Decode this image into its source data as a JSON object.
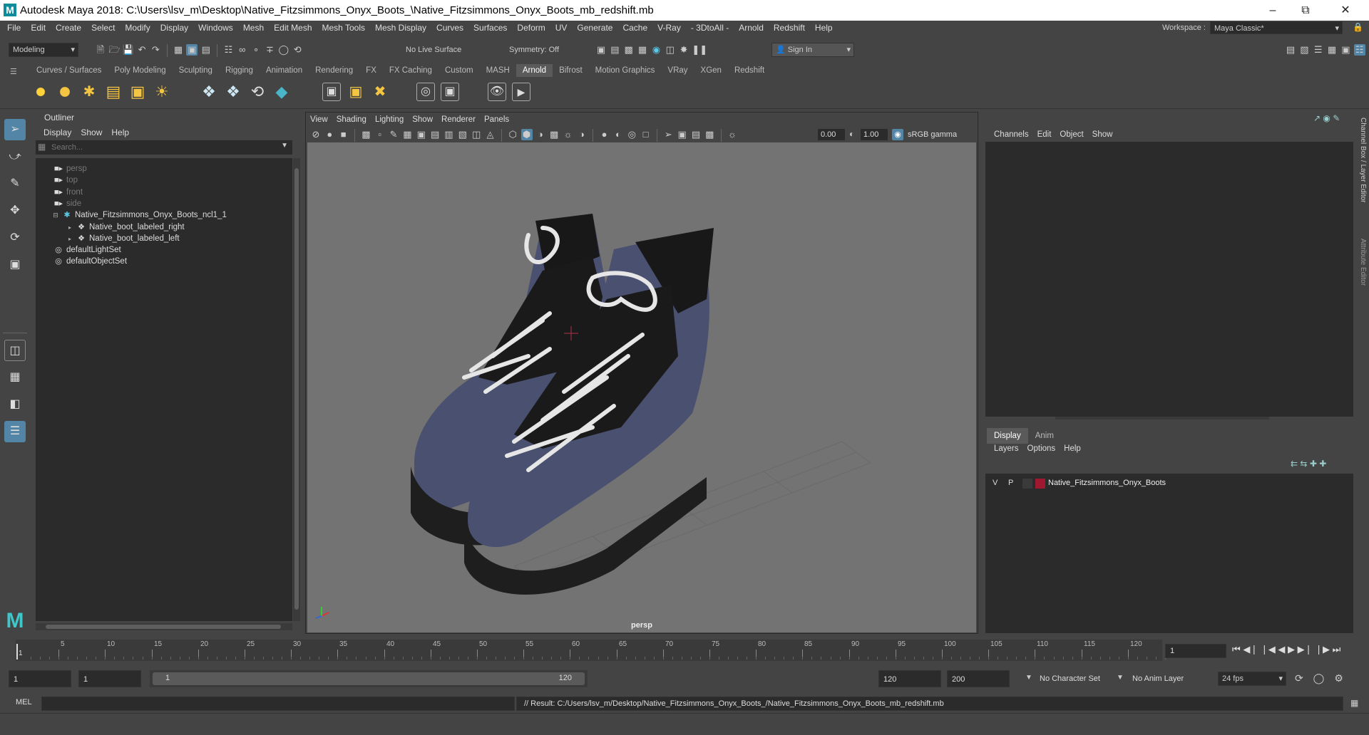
{
  "app": {
    "title": "Autodesk Maya 2018: C:\\Users\\lsv_m\\Desktop\\Native_Fitzsimmons_Onyx_Boots_\\Native_Fitzsimmons_Onyx_Boots_mb_redshift.mb",
    "logo_letter": "M",
    "accent_color": "#5285a6"
  },
  "menubar": [
    "File",
    "Edit",
    "Create",
    "Select",
    "Modify",
    "Display",
    "Windows",
    "Mesh",
    "Edit Mesh",
    "Mesh Tools",
    "Mesh Display",
    "Curves",
    "Surfaces",
    "Deform",
    "UV",
    "Generate",
    "Cache",
    "V-Ray",
    "- 3DtoAll -",
    "Arnold",
    "Redshift",
    "Help"
  ],
  "workspace": {
    "label": "Workspace :",
    "value": "Maya Classic*"
  },
  "statusline": {
    "mode": "Modeling",
    "live_surface": "No Live Surface",
    "symmetry": "Symmetry: Off",
    "sign_in": "Sign In"
  },
  "shelf_tabs": [
    "Curves / Surfaces",
    "Poly Modeling",
    "Sculpting",
    "Rigging",
    "Animation",
    "Rendering",
    "FX",
    "FX Caching",
    "Custom",
    "MASH",
    "Arnold",
    "Bifrost",
    "Motion Graphics",
    "VRay",
    "XGen",
    "Redshift"
  ],
  "active_shelf": "Arnold",
  "outliner": {
    "title": "Outliner",
    "menu": [
      "Display",
      "Show",
      "Help"
    ],
    "search_placeholder": "Search...",
    "items": [
      {
        "label": "persp",
        "icon": "camera-icon",
        "dim": true
      },
      {
        "label": "top",
        "icon": "camera-icon",
        "dim": true
      },
      {
        "label": "front",
        "icon": "camera-icon",
        "dim": true
      },
      {
        "label": "side",
        "icon": "camera-icon",
        "dim": true
      },
      {
        "label": "Native_Fitzsimmons_Onyx_Boots_ncl1_1",
        "icon": "group-icon",
        "dim": false
      },
      {
        "label": "Native_boot_labeled_right",
        "icon": "mesh-icon",
        "dim": false
      },
      {
        "label": "Native_boot_labeled_left",
        "icon": "mesh-icon",
        "dim": false
      },
      {
        "label": "defaultLightSet",
        "icon": "set-icon",
        "dim": false
      },
      {
        "label": "defaultObjectSet",
        "icon": "set-icon",
        "dim": false
      }
    ]
  },
  "viewport": {
    "menu": [
      "View",
      "Shading",
      "Lighting",
      "Show",
      "Renderer",
      "Panels"
    ],
    "exposure": "0.00",
    "gamma": "1.00",
    "color_space": "sRGB gamma",
    "camera_label": "persp"
  },
  "channelbox": {
    "menu": [
      "Channels",
      "Edit",
      "Object",
      "Show"
    ],
    "side_tabs": [
      "Channel Box / Layer Editor",
      "Attribute Editor"
    ],
    "layer_tabs": [
      "Display",
      "Anim"
    ],
    "layer_menu": [
      "Layers",
      "Options",
      "Help"
    ],
    "layer": {
      "v": "V",
      "p": "P",
      "name": "Native_Fitzsimmons_Onyx_Boots",
      "color": "#a01830"
    }
  },
  "timeline": {
    "ticks": [
      "5",
      "10",
      "15",
      "20",
      "25",
      "30",
      "35",
      "40",
      "45",
      "50",
      "55",
      "60",
      "65",
      "70",
      "75",
      "80",
      "85",
      "90",
      "95",
      "100",
      "105",
      "110",
      "115",
      "120"
    ],
    "first_tick": "1",
    "current_frame": "1"
  },
  "range": {
    "start": "1",
    "playback_start": "1",
    "slider_start": "1",
    "slider_end": "120",
    "playback_end": "120",
    "end": "200",
    "character_set": "No Character Set",
    "anim_layer": "No Anim Layer",
    "fps": "24 fps"
  },
  "cmdline": {
    "label": "MEL",
    "result": "// Result: C:/Users/lsv_m/Desktop/Native_Fitzsimmons_Onyx_Boots_/Native_Fitzsimmons_Onyx_Boots_mb_redshift.mb"
  }
}
